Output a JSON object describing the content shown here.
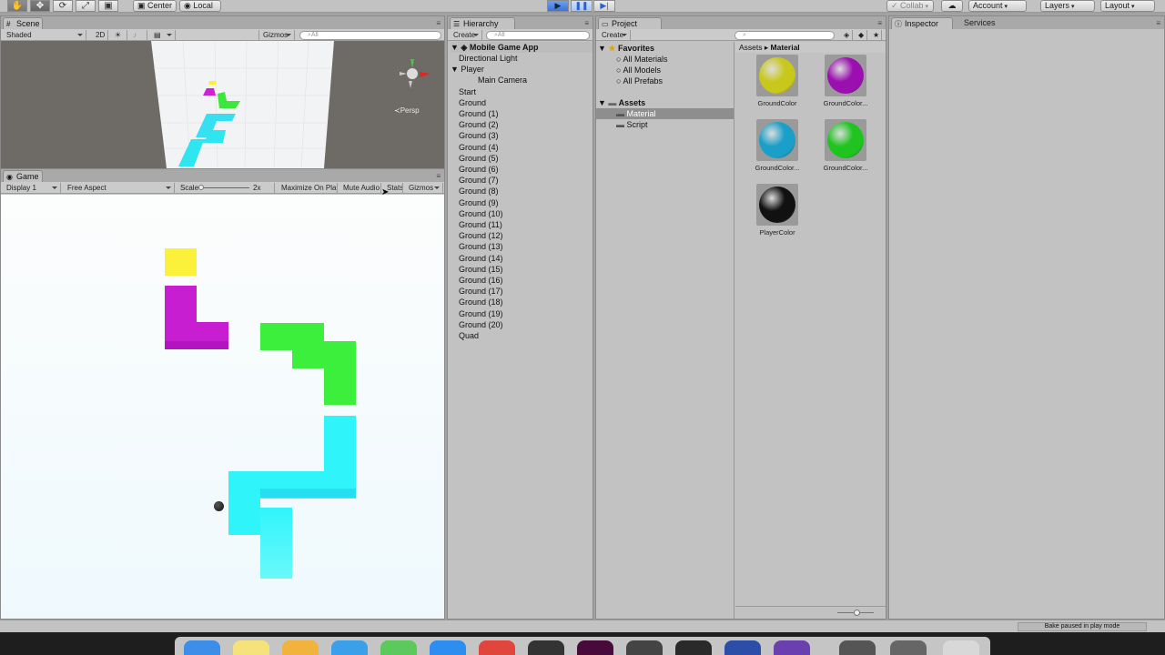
{
  "toolbar": {
    "tools": [
      "hand-icon",
      "move-icon",
      "rotate-icon",
      "scale-icon",
      "rect-icon"
    ],
    "pivot": "Center",
    "space": "Local",
    "collab": "Collab",
    "account": "Account",
    "layers": "Layers",
    "layout": "Layout"
  },
  "scene": {
    "tab": "Scene",
    "shading": "Shaded",
    "mode2d": "2D",
    "gizmos": "Gizmos",
    "search_placeholder": "All",
    "persp": "Persp"
  },
  "game": {
    "tab": "Game",
    "display": "Display 1",
    "aspect": "Free Aspect",
    "scale_label": "Scale",
    "scale_value": "2x",
    "maximize": "Maximize On Play",
    "mute": "Mute Audio",
    "stats": "Stats",
    "gizmos": "Gizmos"
  },
  "hierarchy": {
    "tab": "Hierarchy",
    "create": "Create",
    "search_placeholder": "All",
    "scene_name": "Mobile Game App",
    "items": [
      {
        "label": "Directional Light",
        "indent": 1,
        "arrow": false
      },
      {
        "label": "Player",
        "indent": 1,
        "arrow": true
      },
      {
        "label": "Main Camera",
        "indent": 2,
        "arrow": false
      },
      {
        "label": "Start",
        "indent": 1,
        "arrow": false
      },
      {
        "label": "Ground",
        "indent": 1,
        "arrow": false
      },
      {
        "label": "Ground (1)",
        "indent": 1,
        "arrow": false
      },
      {
        "label": "Ground (2)",
        "indent": 1,
        "arrow": false
      },
      {
        "label": "Ground (3)",
        "indent": 1,
        "arrow": false
      },
      {
        "label": "Ground (4)",
        "indent": 1,
        "arrow": false
      },
      {
        "label": "Ground (5)",
        "indent": 1,
        "arrow": false
      },
      {
        "label": "Ground (6)",
        "indent": 1,
        "arrow": false
      },
      {
        "label": "Ground (7)",
        "indent": 1,
        "arrow": false
      },
      {
        "label": "Ground (8)",
        "indent": 1,
        "arrow": false
      },
      {
        "label": "Ground (9)",
        "indent": 1,
        "arrow": false
      },
      {
        "label": "Ground (10)",
        "indent": 1,
        "arrow": false
      },
      {
        "label": "Ground (11)",
        "indent": 1,
        "arrow": false
      },
      {
        "label": "Ground (12)",
        "indent": 1,
        "arrow": false
      },
      {
        "label": "Ground (13)",
        "indent": 1,
        "arrow": false
      },
      {
        "label": "Ground (14)",
        "indent": 1,
        "arrow": false
      },
      {
        "label": "Ground (15)",
        "indent": 1,
        "arrow": false
      },
      {
        "label": "Ground (16)",
        "indent": 1,
        "arrow": false
      },
      {
        "label": "Ground (17)",
        "indent": 1,
        "arrow": false
      },
      {
        "label": "Ground (18)",
        "indent": 1,
        "arrow": false
      },
      {
        "label": "Ground (19)",
        "indent": 1,
        "arrow": false
      },
      {
        "label": "Ground (20)",
        "indent": 1,
        "arrow": false
      },
      {
        "label": "Quad",
        "indent": 1,
        "arrow": false
      }
    ]
  },
  "project": {
    "tab": "Project",
    "create": "Create",
    "favorites": "Favorites",
    "fav_items": [
      "All Materials",
      "All Models",
      "All Prefabs"
    ],
    "assets": "Assets",
    "asset_folders": [
      "Material",
      "Script"
    ],
    "breadcrumb": [
      "Assets",
      "Material"
    ],
    "materials": [
      {
        "name": "GroundColor",
        "color": "#c8c81c"
      },
      {
        "name": "GroundColor...",
        "color": "#9b0fb0"
      },
      {
        "name": "GroundColor...",
        "color": "#1a9fc8"
      },
      {
        "name": "GroundColor...",
        "color": "#1fc41f"
      },
      {
        "name": "PlayerColor",
        "color": "#111111"
      }
    ]
  },
  "inspector": {
    "tab": "Inspector",
    "services": "Services"
  },
  "status": {
    "message": "Bake paused in play mode"
  },
  "colors": {
    "yellow": "#fcf23c",
    "magenta": "#c81ed2",
    "green": "#3cef3c",
    "cyan": "#2ff5fb"
  }
}
